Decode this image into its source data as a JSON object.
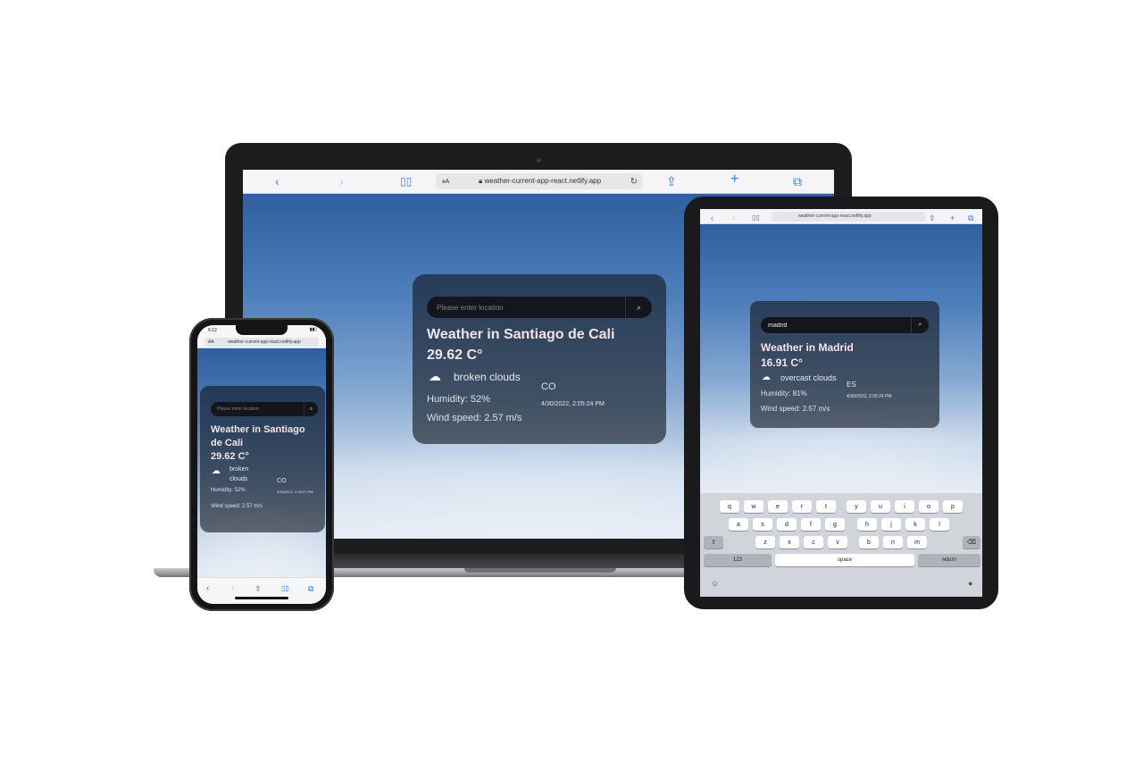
{
  "colors": {
    "card_bg": "rgba(20,24,32,0.62)",
    "title_text": "#f3e2e6",
    "safari_blue": "#2d7cf6",
    "device_frame": "#1d1d1f"
  },
  "laptop": {
    "browser": {
      "text_size_label": "ᴀA",
      "url": "weather-current-app-react.netlify.app",
      "icons": [
        "chevron-left-icon",
        "chevron-right-icon",
        "book-icon",
        "share-icon",
        "plus-icon",
        "tabs-icon",
        "reload-icon",
        "lock-icon"
      ]
    },
    "weather": {
      "search_placeholder": "Please enter location",
      "title": "Weather in Santiago de Cali",
      "temperature": "29.62 C°",
      "description": "broken clouds",
      "humidity": "Humidity: 52%",
      "wind": "Wind speed: 2.57 m/s",
      "country": "CO",
      "datetime": "4/30/2022, 2:05:24 PM"
    }
  },
  "tablet": {
    "browser": {
      "url": "weather-current-app-react.netlify.app"
    },
    "weather": {
      "search_value": "madrid",
      "title": "Weather in Madrid",
      "temperature": "16.91 C°",
      "description": "overcast clouds",
      "humidity": "Humidity: 81%",
      "wind": "Wind speed: 2.57 m/s",
      "country": "ES",
      "datetime": "4/30/2022, 2:05:24 PM"
    },
    "keyboard": {
      "row1": [
        "q",
        "w",
        "e",
        "r",
        "t",
        "y",
        "u",
        "i",
        "o",
        "p"
      ],
      "row2": [
        "a",
        "s",
        "d",
        "f",
        "g",
        "h",
        "j",
        "k",
        "l"
      ],
      "row3": [
        "z",
        "x",
        "c",
        "v",
        "b",
        "n",
        "m"
      ],
      "shift": "⇧",
      "backspace": "⌫",
      "numbers": "123",
      "space": "space",
      "return": "return"
    }
  },
  "phone": {
    "status_time": "6:12",
    "browser": {
      "text_size_label": "AA",
      "url": "weather-current-app-react.netlify.app"
    },
    "weather": {
      "search_placeholder": "Please enter location",
      "title": "Weather in Santiago de Cali",
      "temperature": "29.62 C°",
      "description": "broken clouds",
      "humidity": "Humidity: 52%",
      "wind": "Wind speed: 2.57 m/s",
      "country": "CO",
      "datetime": "4/30/2022, 2:05:27 PM"
    }
  }
}
